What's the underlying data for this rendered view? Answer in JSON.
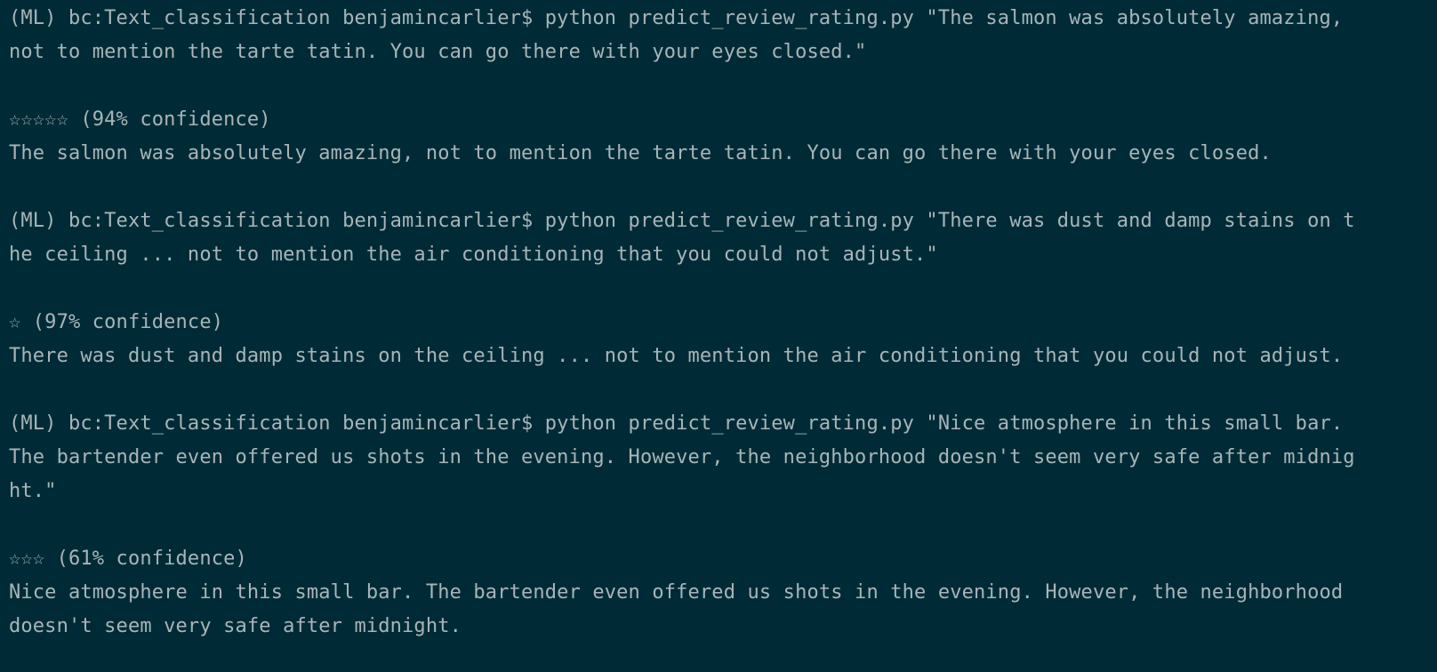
{
  "terminal": {
    "colors": {
      "background": "#002b36",
      "text": "#a7b5b8"
    },
    "blocks": [
      {
        "prompt": "(ML) bc:Text_classification benjamincarlier$ ",
        "command_lines": [
          "python predict_review_rating.py \"The salmon was absolutely amazing,",
          "not to mention the tarte tatin. You can go there with your eyes closed.\""
        ],
        "rating": "☆☆☆☆☆ (94% confidence)",
        "review_lines": [
          "The salmon was absolutely amazing, not to mention the tarte tatin. You can go there with your eyes closed."
        ]
      },
      {
        "prompt": "(ML) bc:Text_classification benjamincarlier$ ",
        "command_lines": [
          "python predict_review_rating.py \"There was dust and damp stains on t",
          "he ceiling ... not to mention the air conditioning that you could not adjust.\""
        ],
        "rating": "☆ (97% confidence)",
        "review_lines": [
          "There was dust and damp stains on the ceiling ... not to mention the air conditioning that you could not adjust."
        ]
      },
      {
        "prompt": "(ML) bc:Text_classification benjamincarlier$ ",
        "command_lines": [
          "python predict_review_rating.py \"Nice atmosphere in this small bar.",
          "The bartender even offered us shots in the evening. However, the neighborhood doesn't seem very safe after midnig",
          "ht.\""
        ],
        "rating": "☆☆☆ (61% confidence)",
        "review_lines": [
          "Nice atmosphere in this small bar. The bartender even offered us shots in the evening. However, the neighborhood",
          "doesn't seem very safe after midnight."
        ]
      }
    ]
  }
}
